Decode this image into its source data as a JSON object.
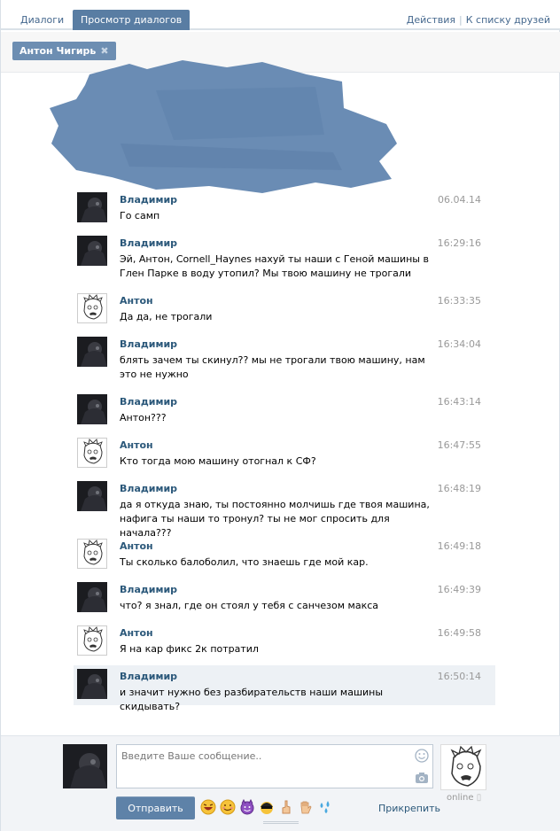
{
  "tabs": [
    {
      "label": "Диалоги"
    },
    {
      "label": "Просмотр диалогов"
    }
  ],
  "top_links": {
    "actions": "Действия",
    "friends_list": "К списку друзей"
  },
  "chip": {
    "name": "Антон Чигирь"
  },
  "messages": [
    {
      "author": "Владимир",
      "time": "06.04.14",
      "text": "Го самп",
      "avatar": "dark"
    },
    {
      "author": "Владимир",
      "time": "16:29:16",
      "text": "Эй, Антон, Cornell_Haynes нахуй ты наши с Геной машины в Глен Парке в воду утопил? Мы твою машину не трогали",
      "avatar": "dark"
    },
    {
      "author": "Антон",
      "time": "16:33:35",
      "text": "Да да, не трогали",
      "avatar": "sketch"
    },
    {
      "author": "Владимир",
      "time": "16:34:04",
      "text": "блять зачем ты скинул?? мы не трогали твою машину, нам это не нужно",
      "avatar": "dark"
    },
    {
      "author": "Владимир",
      "time": "16:43:14",
      "text": "Антон???",
      "avatar": "dark"
    },
    {
      "author": "Антон",
      "time": "16:47:55",
      "text": "Кто тогда мою машину отогнал к СФ?",
      "avatar": "sketch"
    },
    {
      "author": "Владимир",
      "time": "16:48:19",
      "text": "да я откуда знаю, ты постоянно молчишь где твоя машина, нафига ты наши то тронул? ты не мог спросить для начала???",
      "avatar": "dark"
    },
    {
      "author": "Антон",
      "time": "16:49:18",
      "text": "Ты сколько балоболил, что знаешь где мой кар.",
      "avatar": "sketch"
    },
    {
      "author": "Владимир",
      "time": "16:49:39",
      "text": "что? я знал, где он стоял у тебя с санчезом макса",
      "avatar": "dark"
    },
    {
      "author": "Антон",
      "time": "16:49:58",
      "text": "Я на кар фикс 2к потратил",
      "avatar": "sketch"
    },
    {
      "author": "Владимир",
      "time": "16:50:14",
      "text": "и значит нужно без разбирательств наши машины скидывать?",
      "avatar": "dark"
    }
  ],
  "compose": {
    "placeholder": "Введите Ваше сообщение..",
    "send_label": "Отправить",
    "attach_label": "Прикрепить",
    "online_label": "online"
  },
  "colors": {
    "accent": "#597da3",
    "link": "#2b587a",
    "highlight": "#edf1f5"
  }
}
